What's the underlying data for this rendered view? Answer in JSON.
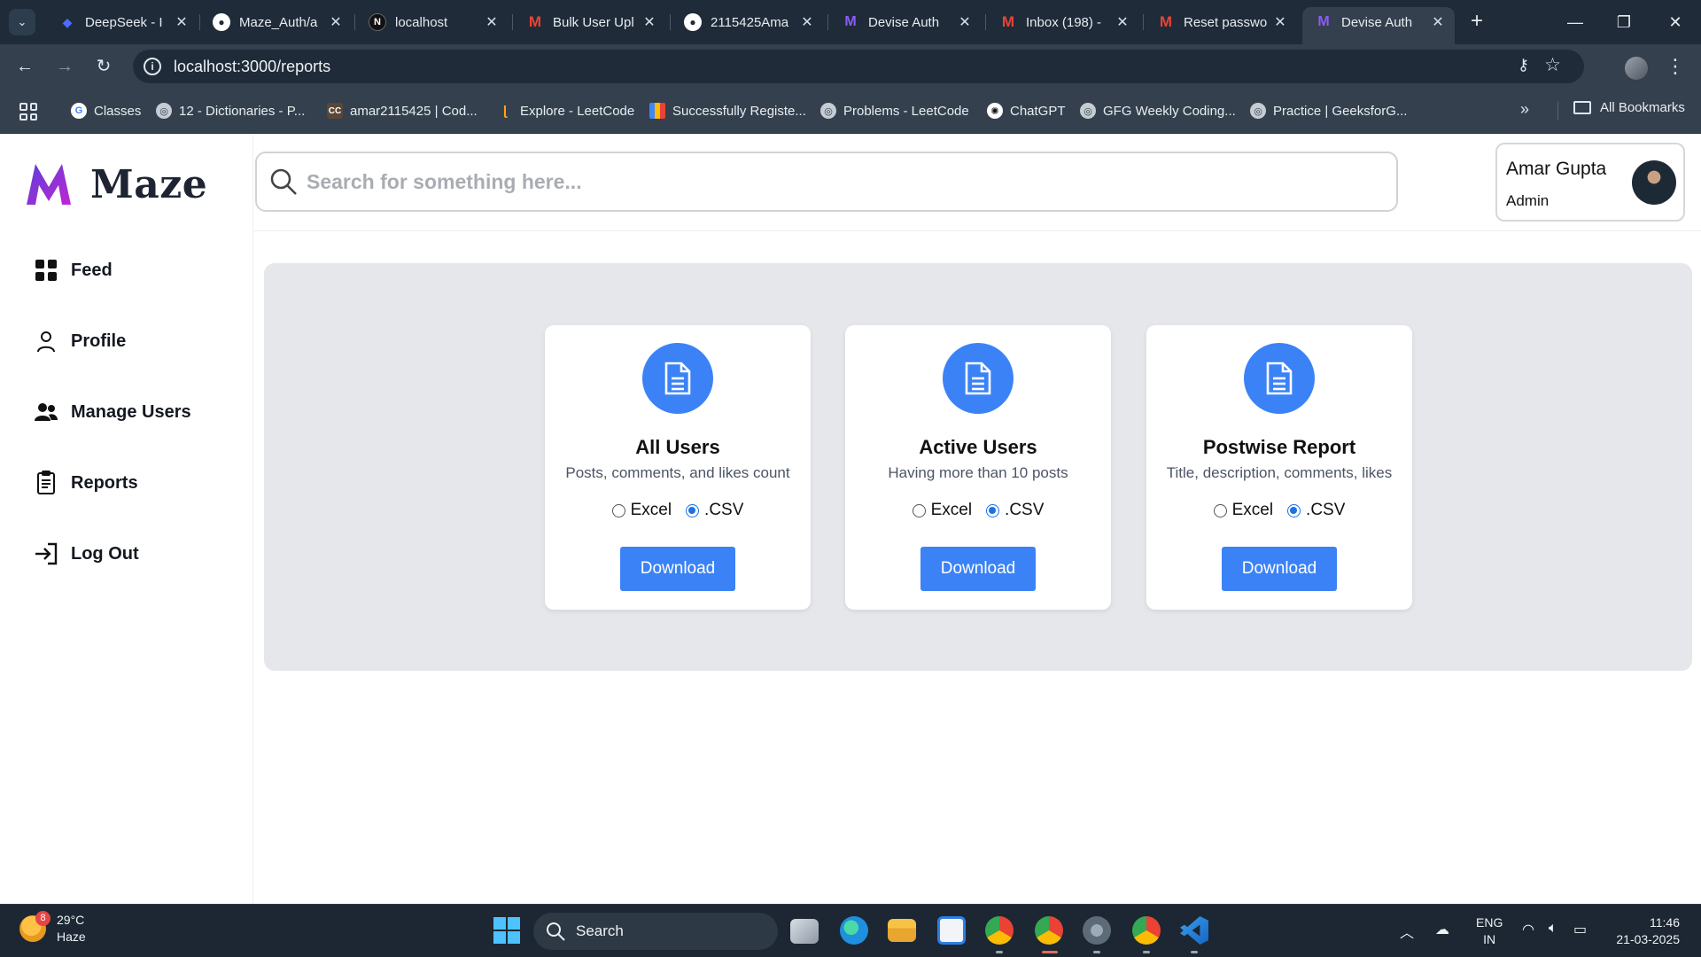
{
  "browser": {
    "tabs": [
      {
        "title": "DeepSeek - I",
        "icon": "deepseek-icon"
      },
      {
        "title": "Maze_Auth/a",
        "icon": "github-icon"
      },
      {
        "title": "localhost",
        "icon": "nextjs-icon"
      },
      {
        "title": "Bulk User Upl",
        "icon": "gmail-icon"
      },
      {
        "title": "2115425Ama",
        "icon": "github-icon"
      },
      {
        "title": "Devise Auth",
        "icon": "maze-icon"
      },
      {
        "title": "Inbox (198) -",
        "icon": "gmail-icon"
      },
      {
        "title": "Reset passwo",
        "icon": "gmail-icon"
      },
      {
        "title": "Devise Auth",
        "icon": "maze-icon",
        "active": true
      }
    ],
    "url": "localhost:3000/reports",
    "bookmarks": [
      {
        "label": "Classes",
        "icon": "google-icon"
      },
      {
        "label": "12 - Dictionaries - P...",
        "icon": "globe-icon"
      },
      {
        "label": "amar2115425 | Cod...",
        "icon": "codechef-icon"
      },
      {
        "label": "Explore - LeetCode",
        "icon": "leetcode-icon"
      },
      {
        "label": "Successfully Registe...",
        "icon": "chart-icon"
      },
      {
        "label": "Problems - LeetCode",
        "icon": "globe-icon"
      },
      {
        "label": "ChatGPT",
        "icon": "openai-icon"
      },
      {
        "label": "GFG Weekly Coding...",
        "icon": "globe-icon"
      },
      {
        "label": "Practice | GeeksforG...",
        "icon": "globe-icon"
      }
    ],
    "all_bookmarks_label": "All Bookmarks"
  },
  "app": {
    "brand": "Maze",
    "search_placeholder": "Search for something here...",
    "user": {
      "name": "Amar Gupta",
      "role": "Admin"
    },
    "nav": [
      {
        "label": "Feed",
        "icon": "grid-icon"
      },
      {
        "label": "Profile",
        "icon": "user-icon"
      },
      {
        "label": "Manage Users",
        "icon": "users-icon"
      },
      {
        "label": "Reports",
        "icon": "clipboard-icon"
      },
      {
        "label": "Log Out",
        "icon": "logout-icon"
      }
    ],
    "reports": [
      {
        "title": "All Users",
        "description": "Posts, comments, and likes count",
        "options": [
          "Excel",
          ".CSV"
        ],
        "selected": ".CSV",
        "button": "Download"
      },
      {
        "title": "Active Users",
        "description": "Having more than 10 posts",
        "options": [
          "Excel",
          ".CSV"
        ],
        "selected": ".CSV",
        "button": "Download"
      },
      {
        "title": "Postwise Report",
        "description": "Title, description, comments, likes",
        "options": [
          "Excel",
          ".CSV"
        ],
        "selected": ".CSV",
        "button": "Download"
      }
    ],
    "colors": {
      "accent": "#3b82f6",
      "panel": "#e5e7eb",
      "brand_gradient": [
        "#7c3aed",
        "#c026d3"
      ]
    }
  },
  "taskbar": {
    "weather": {
      "temp": "29°C",
      "condition": "Haze",
      "badge": "8"
    },
    "search_label": "Search",
    "lang": [
      "ENG",
      "IN"
    ],
    "time": "11:46",
    "date": "21-03-2025"
  }
}
